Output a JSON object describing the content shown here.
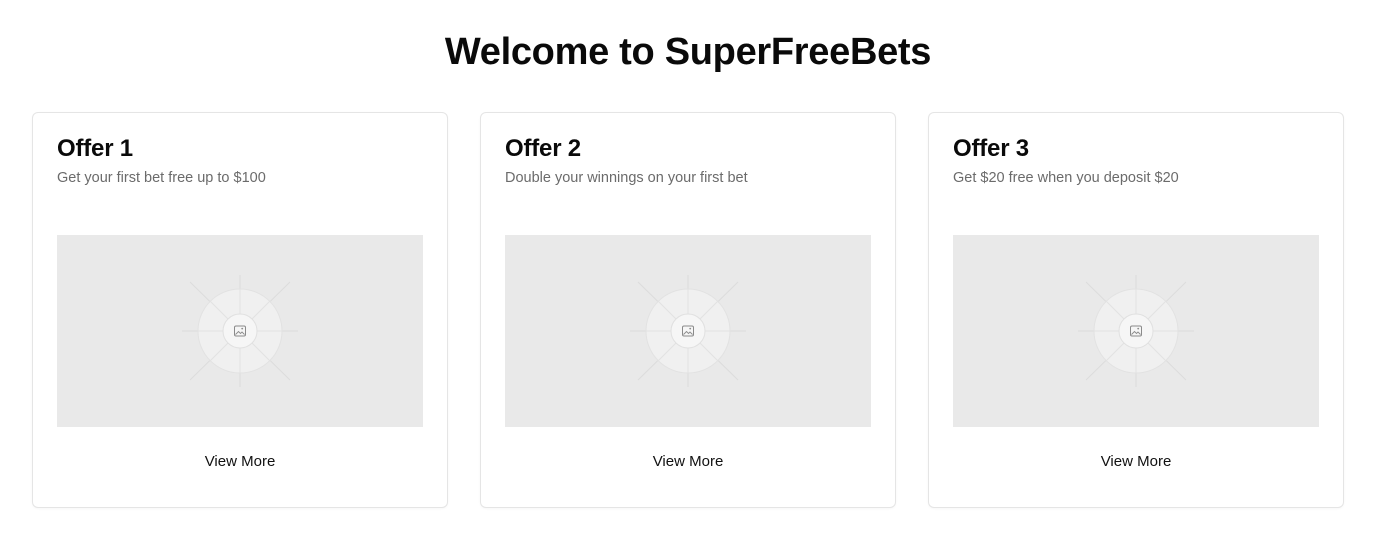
{
  "header": {
    "title": "Welcome to SuperFreeBets"
  },
  "offers": [
    {
      "title": "Offer 1",
      "description": "Get your first bet free up to $100",
      "image_icon": "image-placeholder-icon",
      "button_label": "View More"
    },
    {
      "title": "Offer 2",
      "description": "Double your winnings on your first bet",
      "image_icon": "image-placeholder-icon",
      "button_label": "View More"
    },
    {
      "title": "Offer 3",
      "description": "Get $20 free when you deposit $20",
      "image_icon": "image-placeholder-icon",
      "button_label": "View More"
    }
  ],
  "colors": {
    "placeholder_bg": "#e9e9e9",
    "card_border": "#e5e5e5",
    "muted_text": "#6b6b6b"
  }
}
